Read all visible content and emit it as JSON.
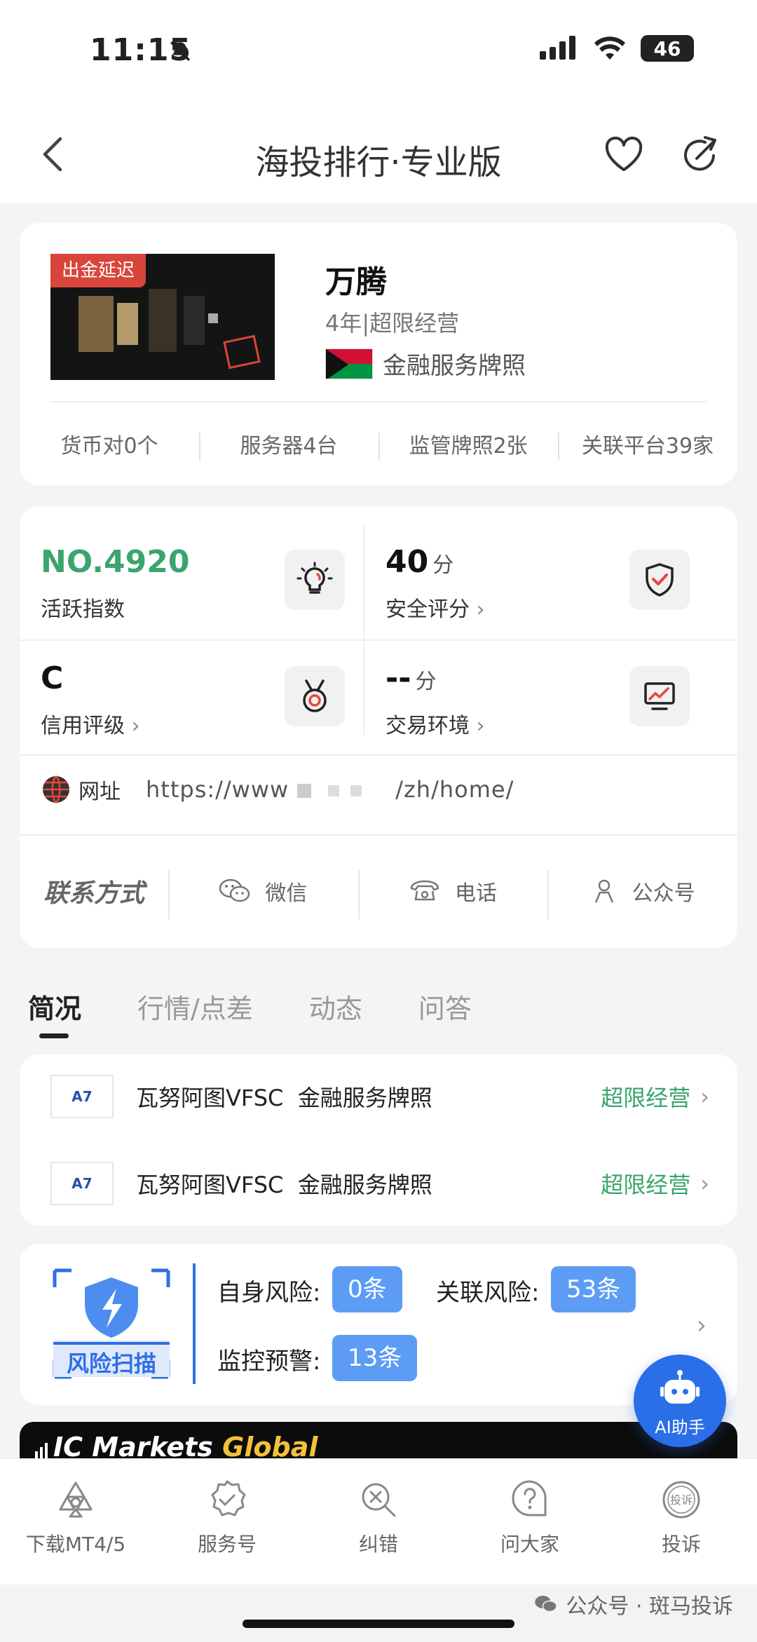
{
  "status_bar": {
    "time": "11:15",
    "battery": "46",
    "icons": [
      "bell-muted-icon",
      "signal-icon",
      "wifi-icon",
      "battery-icon"
    ]
  },
  "nav": {
    "title": "海投排行·专业版",
    "icons": [
      "back-arrow-icon",
      "heart-icon",
      "share-icon"
    ]
  },
  "broker": {
    "status_tag": "出金延迟",
    "name": "万腾",
    "subtitle": "4年|超限经营",
    "license": "金融服务牌照",
    "stats": [
      {
        "label": "货币对0个"
      },
      {
        "label": "服务器4台"
      },
      {
        "label": "监管牌照2张"
      },
      {
        "label": "关联平台39家"
      }
    ]
  },
  "metrics": {
    "activity": {
      "value": "NO.4920",
      "label": "活跃指数",
      "icon": "lightbulb-icon"
    },
    "safety": {
      "value": "40",
      "unit": "分",
      "label": "安全评分",
      "icon": "shield-check-icon"
    },
    "credit": {
      "value": "C",
      "label": "信用评级",
      "icon": "medal-icon"
    },
    "trading": {
      "value": "--",
      "unit": "分",
      "label": "交易环境",
      "icon": "monitor-chart-icon"
    },
    "website": {
      "label": "网址",
      "url": "https://www",
      "url_tail": "/zh/home/"
    },
    "contact": {
      "title": "联系方式",
      "items": [
        {
          "label": "微信",
          "icon": "wechat-icon"
        },
        {
          "label": "电话",
          "icon": "phone-icon"
        },
        {
          "label": "公众号",
          "icon": "person-icon"
        }
      ]
    }
  },
  "tabs": [
    {
      "label": "简况",
      "active": true
    },
    {
      "label": "行情/点差",
      "active": false
    },
    {
      "label": "动态",
      "active": false
    },
    {
      "label": "问答",
      "active": false
    }
  ],
  "licenses": [
    {
      "regulator": "瓦努阿图VFSC",
      "type": "金融服务牌照",
      "status": "超限经营"
    },
    {
      "regulator": "瓦努阿图VFSC",
      "type": "金融服务牌照",
      "status": "超限经营"
    }
  ],
  "risk": {
    "badge_label": "风险扫描",
    "self_risk_label": "自身风险:",
    "self_risk_value": "0条",
    "related_risk_label": "关联风险:",
    "related_risk_value": "53条",
    "monitor_label": "监控预警:",
    "monitor_value": "13条"
  },
  "banner": {
    "text_white": "IC Markets",
    "text_gold": "Global"
  },
  "ai_button": {
    "label": "AI助手"
  },
  "bottom_nav": [
    {
      "label": "下载MT4/5",
      "icon": "mt-download-icon"
    },
    {
      "label": "服务号",
      "icon": "badge-check-icon"
    },
    {
      "label": "纠错",
      "icon": "search-x-icon"
    },
    {
      "label": "问大家",
      "icon": "question-bubble-icon"
    },
    {
      "label": "投诉",
      "icon": "complaint-icon"
    }
  ],
  "watermark": "公众号 · 斑马投诉",
  "colors": {
    "green": "#3aa56d",
    "blue": "#5c9cf4",
    "accent_blue": "#2a6fe8",
    "red_tag": "#d9453a"
  }
}
